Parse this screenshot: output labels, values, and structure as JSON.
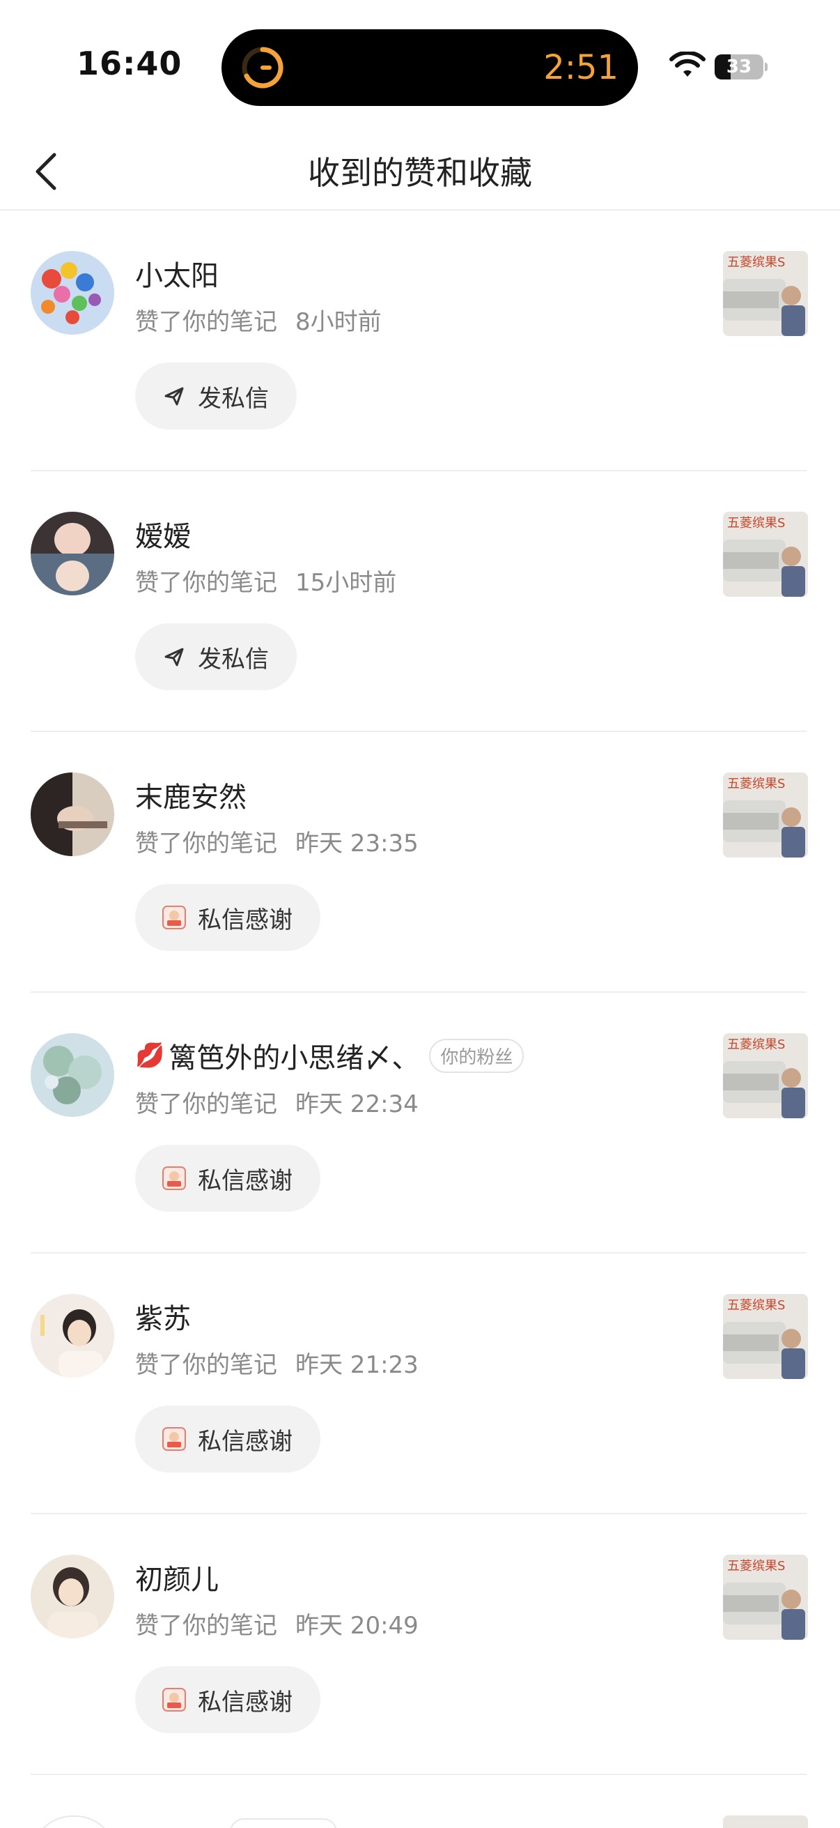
{
  "status_bar": {
    "time": "16:40",
    "timer": "2:51",
    "battery": "33",
    "battery_level": 0.33,
    "accent_color": "#f5a23a"
  },
  "header": {
    "title": "收到的赞和收藏",
    "back_icon": "chevron-left-icon"
  },
  "notifications": [
    {
      "name": "小太阳",
      "action": "赞了你的笔记",
      "time": "8小时前",
      "button": "发私信",
      "button_icon": "send-icon",
      "fan_badge": ""
    },
    {
      "name": "嫒嫒",
      "action": "赞了你的笔记",
      "time": "15小时前",
      "button": "发私信",
      "button_icon": "send-icon",
      "fan_badge": ""
    },
    {
      "name": "末鹿安然",
      "action": "赞了你的笔记",
      "time": "昨天 23:35",
      "button": "私信感谢",
      "button_icon": "thank-sticker-icon",
      "fan_badge": ""
    },
    {
      "name": "篱笆外的小思绪〆、",
      "action": "赞了你的笔记",
      "time": "昨天 22:34",
      "button": "私信感谢",
      "button_icon": "thank-sticker-icon",
      "fan_badge": "你的粉丝",
      "name_emoji": "💋"
    },
    {
      "name": "紫苏",
      "action": "赞了你的笔记",
      "time": "昨天 21:23",
      "button": "私信感谢",
      "button_icon": "thank-sticker-icon",
      "fan_badge": ""
    },
    {
      "name": "初颜儿",
      "action": "赞了你的笔记",
      "time": "昨天 20:49",
      "button": "私信感谢",
      "button_icon": "thank-sticker-icon",
      "fan_badge": ""
    }
  ],
  "thumbnail_caption": "五菱缤果S"
}
